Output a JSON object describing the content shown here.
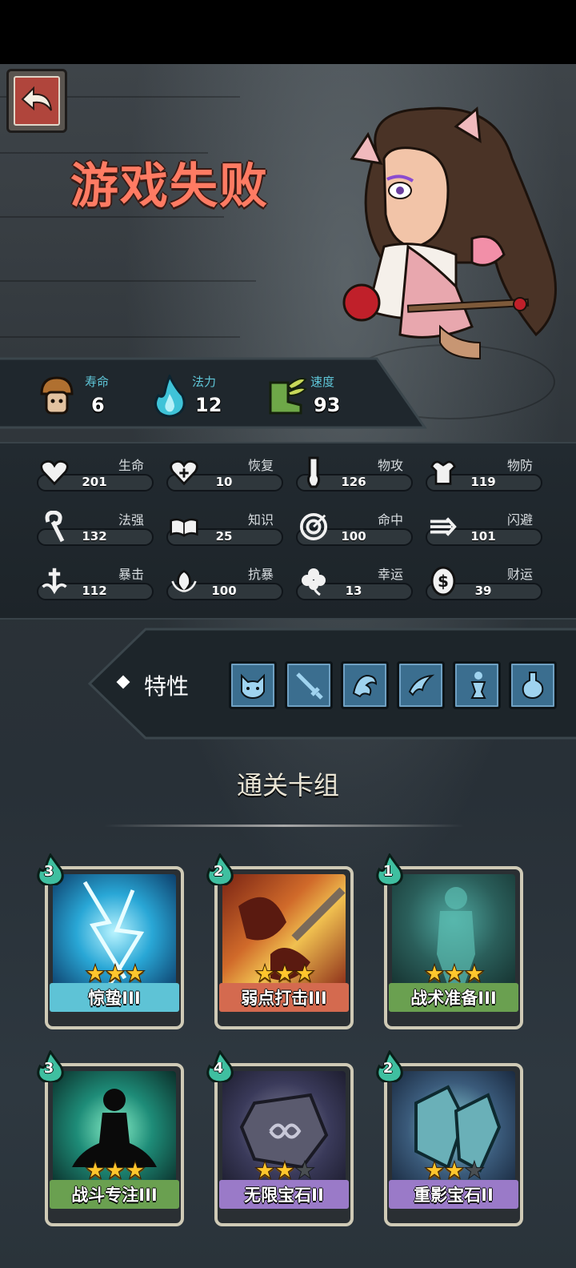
{
  "title": "游戏失败",
  "primary_stats": [
    {
      "label": "寿命",
      "value": "6",
      "icon": "mushroom-icon"
    },
    {
      "label": "法力",
      "value": "12",
      "icon": "mana-flame-icon"
    },
    {
      "label": "速度",
      "value": "93",
      "icon": "winged-boot-icon"
    }
  ],
  "attributes": [
    {
      "label": "生命",
      "value": "201",
      "icon": "heart-icon"
    },
    {
      "label": "恢复",
      "value": "10",
      "icon": "heart-plus-icon"
    },
    {
      "label": "物攻",
      "value": "126",
      "icon": "fist-icon"
    },
    {
      "label": "物防",
      "value": "119",
      "icon": "armor-icon"
    },
    {
      "label": "法强",
      "value": "132",
      "icon": "staff-icon"
    },
    {
      "label": "知识",
      "value": "25",
      "icon": "book-icon"
    },
    {
      "label": "命中",
      "value": "100",
      "icon": "target-icon"
    },
    {
      "label": "闪避",
      "value": "101",
      "icon": "dodge-arrow-icon"
    },
    {
      "label": "暴击",
      "value": "112",
      "icon": "critical-sword-icon"
    },
    {
      "label": "抗暴",
      "value": "100",
      "icon": "shield-flower-icon"
    },
    {
      "label": "幸运",
      "value": "13",
      "icon": "clover-icon"
    },
    {
      "label": "财运",
      "value": "39",
      "icon": "coin-icon"
    }
  ],
  "traits": {
    "label": "特性",
    "icons": [
      "cat-face-icon",
      "sword-icon",
      "dragon-icon",
      "dash-icon",
      "figure-icon",
      "potion-icon"
    ]
  },
  "deck": {
    "title": "通关卡组",
    "cards": [
      {
        "name": "惊蛰III",
        "cost": "3",
        "stars": 3,
        "max_stars": 3,
        "theme": "lightning",
        "color": "#5ec3d6"
      },
      {
        "name": "弱点打击III",
        "cost": "2",
        "stars": 3,
        "max_stars": 3,
        "theme": "weakness",
        "color": "#d46a4f"
      },
      {
        "name": "战术准备III",
        "cost": "1",
        "stars": 3,
        "max_stars": 3,
        "theme": "tactics",
        "color": "#6aa050"
      },
      {
        "name": "战斗专注III",
        "cost": "3",
        "stars": 3,
        "max_stars": 3,
        "theme": "focus",
        "color": "#6aa050"
      },
      {
        "name": "无限宝石II",
        "cost": "4",
        "stars": 2,
        "max_stars": 3,
        "theme": "gem",
        "color": "#9a7ac8"
      },
      {
        "name": "重影宝石II",
        "cost": "2",
        "stars": 2,
        "max_stars": 3,
        "theme": "gem2",
        "color": "#9a7ac8"
      }
    ]
  },
  "colors": {
    "title": "#ff7b63",
    "stat_label": "#5fc7d9",
    "star": "#ffc62d"
  }
}
